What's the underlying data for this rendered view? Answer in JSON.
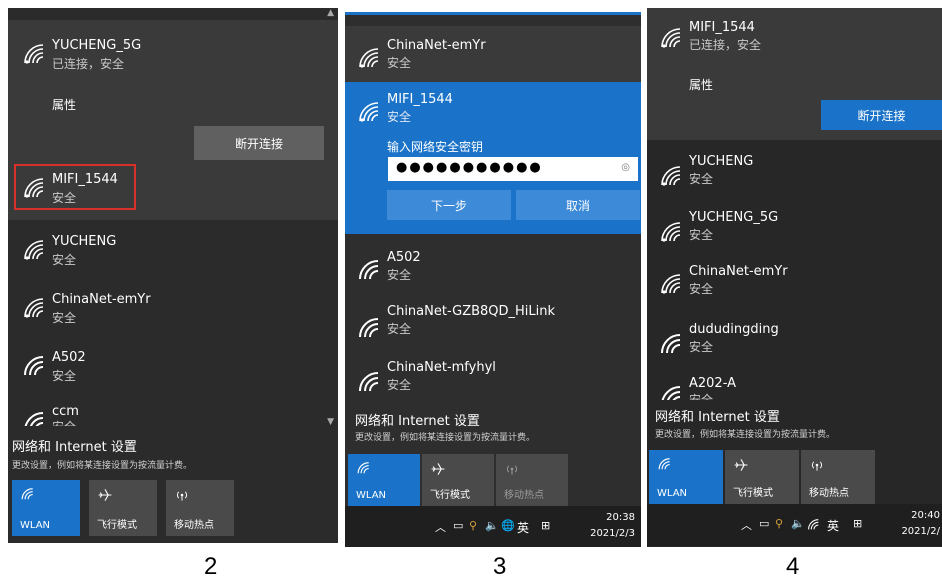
{
  "panel2": {
    "connected": {
      "ssid": "YUCHENG_5G",
      "status": "已连接，安全",
      "properties": "属性",
      "disconnect": "断开连接"
    },
    "networks": [
      {
        "ssid": "MIFI_1544",
        "status": "安全"
      },
      {
        "ssid": "YUCHENG",
        "status": "安全"
      },
      {
        "ssid": "ChinaNet-emYr",
        "status": "安全"
      },
      {
        "ssid": "A502",
        "status": "安全"
      },
      {
        "ssid": "ccm",
        "status": "安全"
      }
    ],
    "footer": {
      "title": "网络和 Internet 设置",
      "desc": "更改设置，例如将某连接设置为按流量计费。"
    },
    "tiles": [
      {
        "label": "WLAN"
      },
      {
        "label": "飞行模式"
      },
      {
        "label": "移动热点"
      }
    ]
  },
  "panel3": {
    "top_network": {
      "ssid": "ChinaNet-emYr",
      "status": "安全"
    },
    "selected": {
      "ssid": "MIFI_1544",
      "status": "安全",
      "prompt": "输入网络安全密钥",
      "password": "●●●●●●●●●●●",
      "next": "下一步",
      "cancel": "取消"
    },
    "networks": [
      {
        "ssid": "A502",
        "status": "安全"
      },
      {
        "ssid": "ChinaNet-GZB8QD_HiLink",
        "status": "安全"
      },
      {
        "ssid": "ChinaNet-mfyhyl",
        "status": "安全"
      }
    ],
    "footer": {
      "title": "网络和 Internet 设置",
      "desc": "更改设置，例如将某连接设置为按流量计费。"
    },
    "tiles": [
      {
        "label": "WLAN"
      },
      {
        "label": "飞行模式"
      },
      {
        "label": "移动热点"
      }
    ],
    "taskbar": {
      "lang": "英",
      "time": "20:38",
      "date": "2021/2/3"
    }
  },
  "panel4": {
    "connected": {
      "ssid": "MIFI_1544",
      "status": "已连接，安全",
      "properties": "属性",
      "disconnect": "断开连接"
    },
    "networks": [
      {
        "ssid": "YUCHENG",
        "status": "安全"
      },
      {
        "ssid": "YUCHENG_5G",
        "status": "安全"
      },
      {
        "ssid": "ChinaNet-emYr",
        "status": "安全"
      },
      {
        "ssid": "dududingding",
        "status": "安全"
      },
      {
        "ssid": "A202-A",
        "status": "安全"
      }
    ],
    "footer": {
      "title": "网络和 Internet 设置",
      "desc": "更改设置，例如将某连接设置为按流量计费。"
    },
    "tiles": [
      {
        "label": "WLAN"
      },
      {
        "label": "飞行模式"
      },
      {
        "label": "移动热点"
      }
    ],
    "taskbar": {
      "lang": "英",
      "time": "20:40",
      "date": "2021/2/"
    }
  },
  "captions": [
    "2",
    "3",
    "4"
  ],
  "colors": {
    "accent": "#1a73c8",
    "highlight": "#d9302c",
    "tile_off": "#4a4a4a",
    "panel_bg": "#2b2b2b"
  }
}
